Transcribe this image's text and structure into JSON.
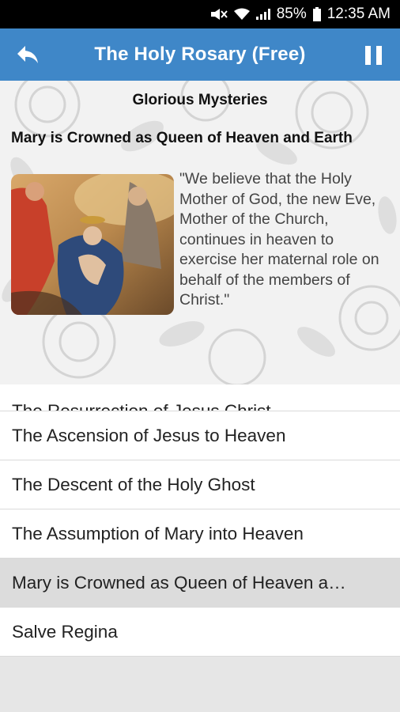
{
  "status_bar": {
    "battery": "85%",
    "time": "12:35 AM"
  },
  "app_bar": {
    "title": "The Holy Rosary (Free)",
    "back_icon": "back-arrow-icon",
    "pause_icon": "pause-icon",
    "color": "#3f87c8"
  },
  "header": {
    "mystery_set": "Glorious Mysteries",
    "mystery_name": "Mary is Crowned as Queen of Heaven and Earth",
    "quote": "\"We believe that the Holy Mother of God, the new Eve, Mother of the Church, continues in heaven to exercise her maternal role on behalf of the members of Christ.\""
  },
  "list": {
    "items": [
      {
        "label": "The Resurrection of Jesus Christ"
      },
      {
        "label": "The Ascension of Jesus to Heaven"
      },
      {
        "label": "The Descent of the Holy Ghost"
      },
      {
        "label": "The Assumption of Mary into Heaven"
      },
      {
        "label": "Mary is Crowned as Queen of Heaven a…"
      },
      {
        "label": "Salve Regina"
      }
    ],
    "selected_index": 4
  }
}
